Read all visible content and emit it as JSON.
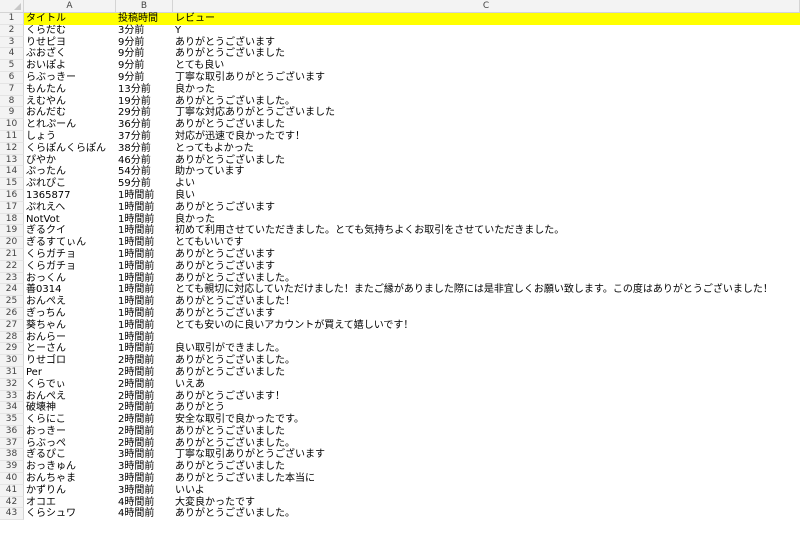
{
  "columns": [
    "A",
    "B",
    "C"
  ],
  "header_fill": "#ffff00",
  "rows": [
    {
      "n": "1",
      "a": "タイトル",
      "b": "投稿時間",
      "c": "レビュー"
    },
    {
      "n": "2",
      "a": "くらだむ",
      "b": "3分前",
      "c": "Y"
    },
    {
      "n": "3",
      "a": "りせピヨ",
      "b": "9分前",
      "c": "ありがとうございます"
    },
    {
      "n": "4",
      "a": "ぶおざく",
      "b": "9分前",
      "c": "ありがとうございました"
    },
    {
      "n": "5",
      "a": "おいぽよ",
      "b": "9分前",
      "c": "とても良い"
    },
    {
      "n": "6",
      "a": "らぶっきー",
      "b": "9分前",
      "c": "丁寧な取引ありがとうございます"
    },
    {
      "n": "7",
      "a": "もんたん",
      "b": "13分前",
      "c": "良かった"
    },
    {
      "n": "8",
      "a": "えむやん",
      "b": "19分前",
      "c": "ありがとうございました。"
    },
    {
      "n": "9",
      "a": "おんだむ",
      "b": "29分前",
      "c": "丁寧な対応ありがとうございました"
    },
    {
      "n": "10",
      "a": "とれぷーん",
      "b": "36分前",
      "c": "ありがとうございました"
    },
    {
      "n": "11",
      "a": "しょう",
      "b": "37分前",
      "c": "対応が迅速で良かったです！"
    },
    {
      "n": "12",
      "a": "くらぽんくらぽん",
      "b": "38分前",
      "c": "とってもよかった"
    },
    {
      "n": "13",
      "a": "ぴやか",
      "b": "46分前",
      "c": "ありがとうございました"
    },
    {
      "n": "14",
      "a": "ぷったん",
      "b": "54分前",
      "c": "助かっています"
    },
    {
      "n": "15",
      "a": "ぷれぴこ",
      "b": "59分前",
      "c": "よい"
    },
    {
      "n": "16",
      "a": "1365877",
      "b": "1時間前",
      "c": "良い"
    },
    {
      "n": "17",
      "a": "ぷれえへ",
      "b": "1時間前",
      "c": "ありがとうございます"
    },
    {
      "n": "18",
      "a": "NotVot",
      "b": "1時間前",
      "c": "良かった"
    },
    {
      "n": "19",
      "a": "ぎるクイ",
      "b": "1時間前",
      "c": "初めて利用させていただきました。とても気持ちよくお取引をさせていただきました。"
    },
    {
      "n": "20",
      "a": "ぎるすてぃん",
      "b": "1時間前",
      "c": "とてもいいです"
    },
    {
      "n": "21",
      "a": "くらガチョ",
      "b": "1時間前",
      "c": "ありがとうございます"
    },
    {
      "n": "22",
      "a": "くらガチョ",
      "b": "1時間前",
      "c": "ありがとうございます"
    },
    {
      "n": "23",
      "a": "おっくん",
      "b": "1時間前",
      "c": "ありがとうございました。"
    },
    {
      "n": "24",
      "a": "善0314",
      "b": "1時間前",
      "c": "とても親切に対応していただけました！またご縁がありました際には是非宜しくお願い致します。この度はありがとうございました！"
    },
    {
      "n": "25",
      "a": "おんぺえ",
      "b": "1時間前",
      "c": "ありがとうございました！"
    },
    {
      "n": "26",
      "a": "ぎっちん",
      "b": "1時間前",
      "c": "ありがとうございます"
    },
    {
      "n": "27",
      "a": "葵ちゃん",
      "b": "1時間前",
      "c": "とても安いのに良いアカウントが買えて嬉しいです！"
    },
    {
      "n": "28",
      "a": "おんらー",
      "b": "1時間前",
      "c": ""
    },
    {
      "n": "29",
      "a": "とーさん",
      "b": "1時間前",
      "c": "良い取引ができました。"
    },
    {
      "n": "30",
      "a": "りせゴロ",
      "b": "2時間前",
      "c": "ありがとうございました。"
    },
    {
      "n": "31",
      "a": "Per",
      "b": "2時間前",
      "c": "ありがとうございました"
    },
    {
      "n": "32",
      "a": "くらでぃ",
      "b": "2時間前",
      "c": "いえあ"
    },
    {
      "n": "33",
      "a": "おんぺえ",
      "b": "2時間前",
      "c": "ありがとうございます！"
    },
    {
      "n": "34",
      "a": "破壊神",
      "b": "2時間前",
      "c": "ありがとう"
    },
    {
      "n": "35",
      "a": "くらにこ",
      "b": "2時間前",
      "c": "安全な取引で良かったです。"
    },
    {
      "n": "36",
      "a": "おっきー",
      "b": "2時間前",
      "c": "ありがとうございました"
    },
    {
      "n": "37",
      "a": "らぶっぺ",
      "b": "2時間前",
      "c": "ありがとうございました。"
    },
    {
      "n": "38",
      "a": "ぎるぴこ",
      "b": "3時間前",
      "c": "丁寧な取引ありがとうございます"
    },
    {
      "n": "39",
      "a": "おっきゅん",
      "b": "3時間前",
      "c": "ありがとうございました"
    },
    {
      "n": "40",
      "a": "おんちゃま",
      "b": "3時間前",
      "c": "ありがとうございました本当に"
    },
    {
      "n": "41",
      "a": "かずりん",
      "b": "3時間前",
      "c": "いいよ"
    },
    {
      "n": "42",
      "a": "オコエ",
      "b": "4時間前",
      "c": "大変良かったです"
    },
    {
      "n": "43",
      "a": "くらシュワ",
      "b": "4時間前",
      "c": "ありがとうございました。"
    }
  ]
}
